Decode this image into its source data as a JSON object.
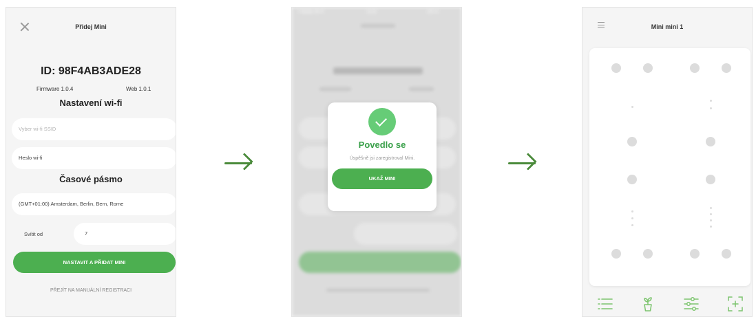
{
  "screen1": {
    "title": "Přidej Mini",
    "device_id": "ID: 98F4AB3ADE28",
    "firmware": "Firmware 1.0.4",
    "web": "Web 1.0.1",
    "wifi_heading": "Nastavení wi-fi",
    "ssid_placeholder": "Vyber wi-fi SSID",
    "password_placeholder": "Heslo wi-fi",
    "timezone_heading": "Časové pásmo",
    "timezone_value": "(GMT+01:00) Amsterdam, Berlin, Bern, Rome",
    "light_from_label": "Svítit od",
    "light_from_value": "7",
    "submit_button": "NASTAVIT A PŘIDAT MINI",
    "manual_link": "PŘEJÍT NA MANUÁLNÍ REGISTRACI"
  },
  "screen2": {
    "status_carrier": "T-Mobile Wi-Fi",
    "status_time": "15:02",
    "status_battery": "100 %",
    "modal_title": "Povedlo se",
    "modal_subtitle": "Úspěšně jsi zaregistroval Mini.",
    "modal_button": "UKAŽ MINI"
  },
  "screen3": {
    "title": "Mini mini 1",
    "nav": [
      "list-icon",
      "plant-icon",
      "sliders-icon",
      "scan-add-icon"
    ]
  },
  "colors": {
    "accent_green": "#4caf50",
    "success_green": "#66cc77",
    "arrow_green": "#4a8a3a",
    "background": "#f5f5f5"
  }
}
